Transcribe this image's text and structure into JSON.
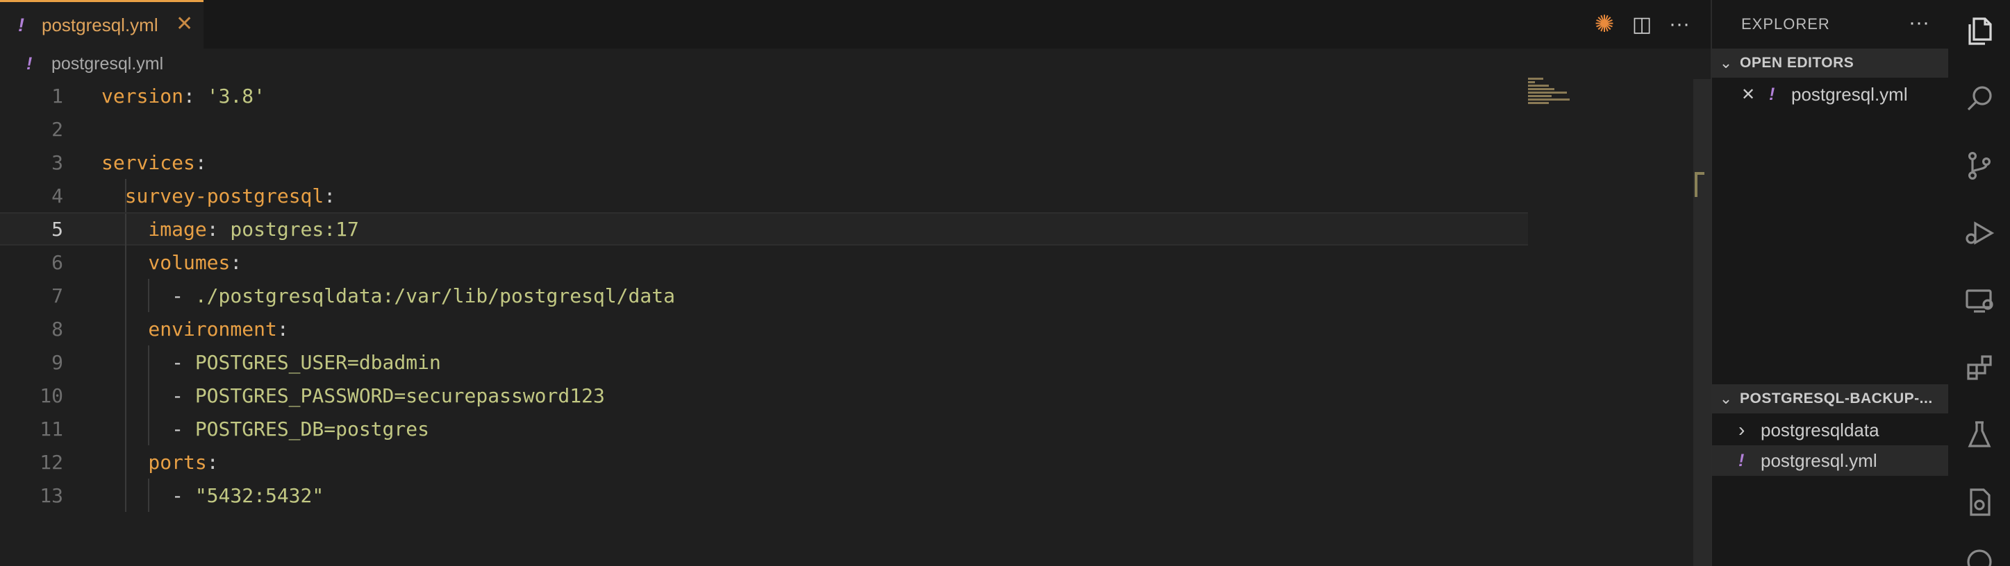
{
  "tab": {
    "icon": "!",
    "filename": "postgresql.yml",
    "close": "✕"
  },
  "breadcrumb": {
    "icon": "!",
    "filename": "postgresql.yml"
  },
  "editor_actions": {
    "copilot": "✺",
    "split": "◫",
    "more": "···"
  },
  "code": {
    "current_line": 5,
    "lines": [
      {
        "n": "1",
        "key": "version",
        "punct": ": ",
        "value": "'3.8'"
      },
      {
        "n": "2"
      },
      {
        "n": "3",
        "key": "services",
        "punct": ":"
      },
      {
        "n": "4",
        "key": "survey-postgresql",
        "punct": ":"
      },
      {
        "n": "5",
        "key": "image",
        "punct": ": ",
        "value": "postgres:17"
      },
      {
        "n": "6",
        "key": "volumes",
        "punct": ":"
      },
      {
        "n": "7",
        "punct": "- ",
        "value": "./postgresqldata:/var/lib/postgresql/data"
      },
      {
        "n": "8",
        "key": "environment",
        "punct": ":"
      },
      {
        "n": "9",
        "punct": "- ",
        "value": "POSTGRES_USER=dbadmin"
      },
      {
        "n": "10",
        "punct": "- ",
        "value": "POSTGRES_PASSWORD=securepassword123"
      },
      {
        "n": "11",
        "punct": "- ",
        "value": "POSTGRES_DB=postgres"
      },
      {
        "n": "12",
        "key": "ports",
        "punct": ":"
      },
      {
        "n": "13",
        "punct": "- ",
        "value": "\"5432:5432\""
      }
    ]
  },
  "explorer": {
    "title": "EXPLORER",
    "more": "···",
    "open_editors": {
      "label": "OPEN EDITORS",
      "items": [
        {
          "close": "✕",
          "icon": "!",
          "name": "postgresql.yml"
        }
      ]
    },
    "folder": {
      "label": "POSTGRESQL-BACKUP-...",
      "items": [
        {
          "type": "folder",
          "chevron": "›",
          "name": "postgresqldata"
        },
        {
          "type": "file",
          "icon": "!",
          "name": "postgresql.yml"
        }
      ]
    }
  },
  "activity_bar": [
    "explorer-icon",
    "search-icon",
    "source-control-icon",
    "run-debug-icon",
    "remote-explorer-icon",
    "extensions-icon",
    "testing-icon",
    "docker-icon",
    "more-icon"
  ],
  "colors": {
    "accent": "#e8a045",
    "yaml_key": "#e8a045",
    "yaml_string": "#c2c883",
    "yaml_file_icon": "#b180d7"
  }
}
